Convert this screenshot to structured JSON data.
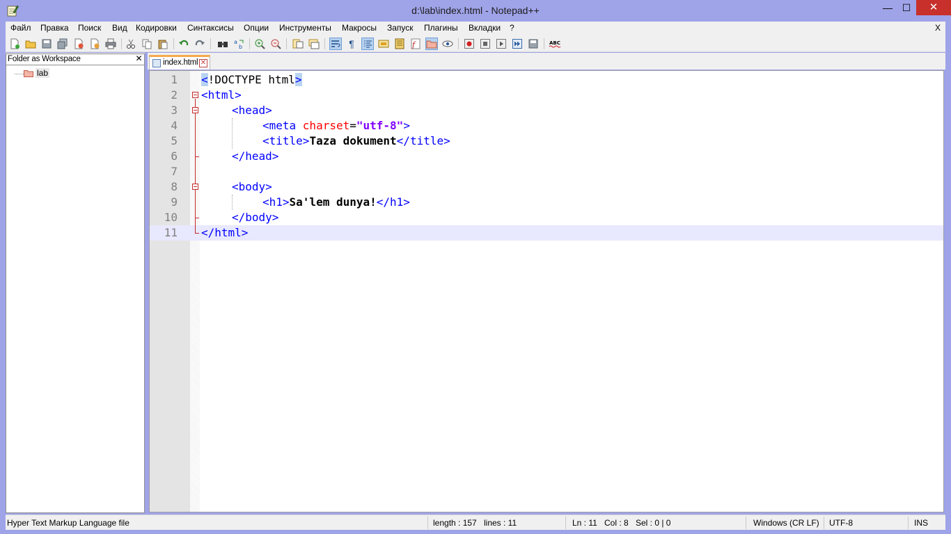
{
  "window": {
    "title": "d:\\lab\\index.html - Notepad++",
    "minimize": "—",
    "maximize": "☐",
    "close": "✕"
  },
  "menu": {
    "items": [
      "Файл",
      "Правка",
      "Поиск",
      "Вид",
      "Кодировки",
      "Синтаксисы",
      "Опции",
      "Инструменты",
      "Макросы",
      "Запуск",
      "Плагины",
      "Вкладки",
      "?"
    ],
    "close": "X"
  },
  "toolbar": {
    "icons": [
      "new-file-icon",
      "open-file-icon",
      "save-icon",
      "save-all-icon",
      "close-icon",
      "close-all-icon",
      "print-icon",
      "cut-icon",
      "copy-icon",
      "paste-icon",
      "undo-icon",
      "redo-icon",
      "find-icon",
      "replace-icon",
      "zoom-in-icon",
      "zoom-out-icon",
      "sync-vertical-icon",
      "sync-horizontal-icon",
      "word-wrap-icon",
      "show-all-chars-icon",
      "indent-guide-icon",
      "user-defined-language-icon",
      "document-map-icon",
      "function-list-icon",
      "folder-as-workspace-icon",
      "monitoring-icon",
      "record-macro-icon",
      "stop-recording-icon",
      "playback-macro-icon",
      "run-macro-multiple-icon",
      "save-macro-icon",
      "spell-check-icon"
    ]
  },
  "panel": {
    "title": "Folder as Workspace",
    "close": "✕",
    "tree": [
      {
        "label": "lab",
        "icon": "folder-icon"
      }
    ]
  },
  "tab": {
    "label": "index.html",
    "close": "✕"
  },
  "editor": {
    "current_line": 11,
    "lines": [
      {
        "n": "1"
      },
      {
        "n": "2"
      },
      {
        "n": "3"
      },
      {
        "n": "4"
      },
      {
        "n": "5"
      },
      {
        "n": "6"
      },
      {
        "n": "7"
      },
      {
        "n": "8"
      },
      {
        "n": "9"
      },
      {
        "n": "10"
      },
      {
        "n": "11"
      }
    ],
    "code": {
      "l1_open": "<",
      "l1_doctype": "!DOCTYPE html",
      "l1_close": ">",
      "l2": "<html>",
      "l3": "<head>",
      "l4_tag_open": "<meta ",
      "l4_attr": "charset",
      "l4_eq": "=",
      "l4_value": "\"utf-8\"",
      "l4_tag_close": ">",
      "l5_open": "<title>",
      "l5_text": "Taza dokument",
      "l5_close": "</title>",
      "l6": "</head>",
      "l8": "<body>",
      "l9_open": "<h1>",
      "l9_text": "Sa'lem dunya!",
      "l9_close": "</h1>",
      "l10": "</body>",
      "l11": "</html>"
    }
  },
  "status": {
    "file_type": "Hyper Text Markup Language file",
    "length": "length : 157",
    "lines": "lines : 11",
    "ln": "Ln : 11",
    "col": "Col : 8",
    "sel": "Sel : 0 | 0",
    "eol": "Windows (CR LF)",
    "encoding": "UTF-8",
    "mode": "INS"
  }
}
